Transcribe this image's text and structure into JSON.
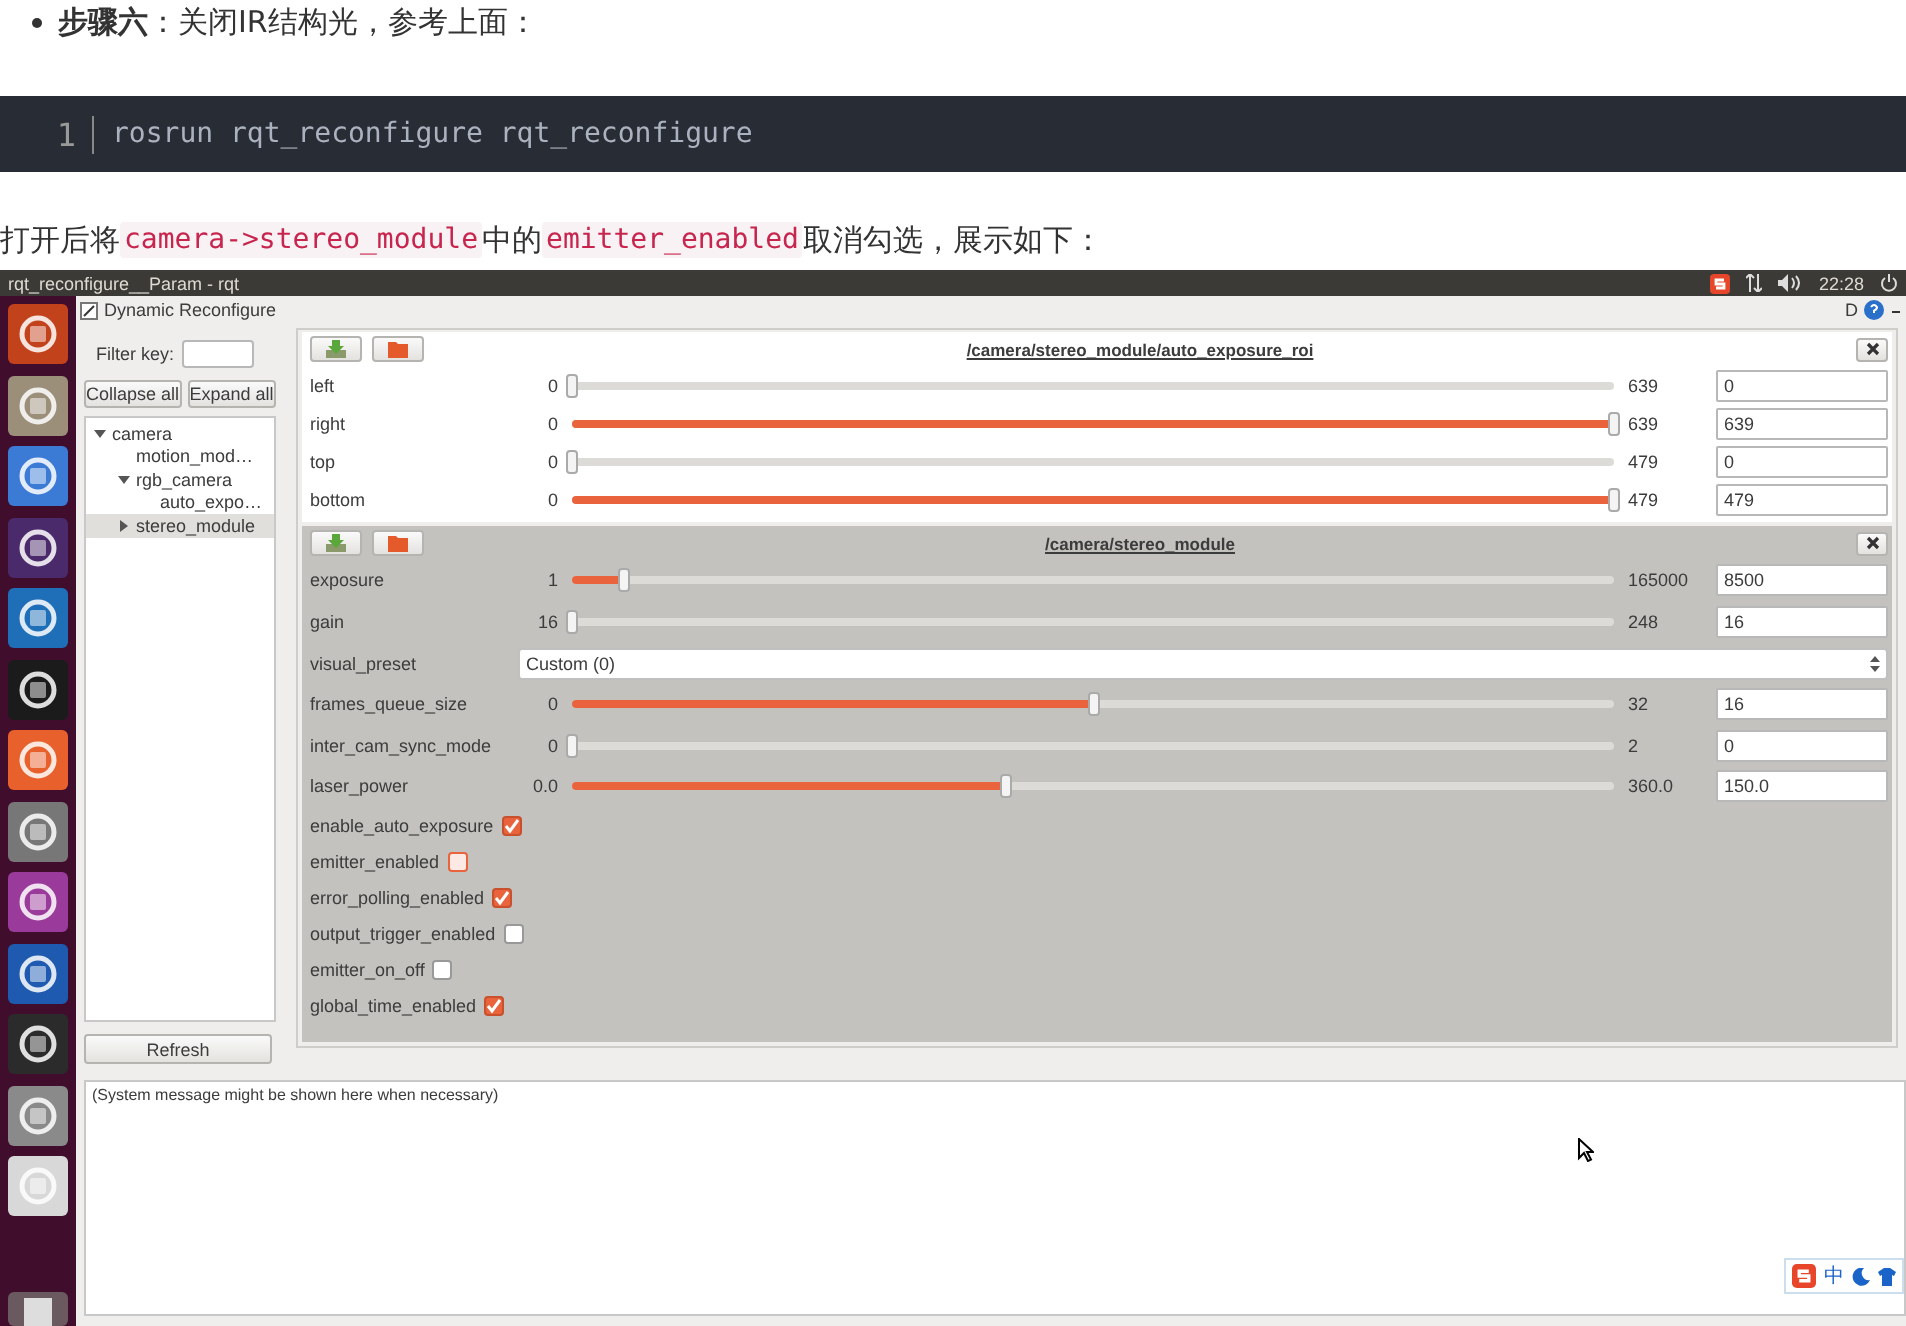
{
  "blog": {
    "bullet": {
      "lead": "步骤六",
      "text": "：关闭IR结构光，参考上面："
    },
    "code_block": {
      "line_number": "1",
      "code": "rosrun rqt_reconfigure rqt_reconfigure"
    },
    "paragraph": [
      {
        "kind": "text",
        "text": "打开后将"
      },
      {
        "kind": "code",
        "text": "camera->stereo_module"
      },
      {
        "kind": "text",
        "text": "中的"
      },
      {
        "kind": "code",
        "text": "emitter_enabled"
      },
      {
        "kind": "text",
        "text": "取消勾选，展示如下："
      }
    ]
  },
  "top_bar": {
    "title": "rqt_reconfigure__Param - rqt",
    "clock": "22:28"
  },
  "plugin": {
    "title": "Dynamic Reconfigure",
    "help": "D"
  },
  "left_panel": {
    "filter_label": "Filter key:",
    "buttons": [
      "Collapse all",
      "Expand all"
    ],
    "tree": [
      {
        "label": "camera",
        "expanded": true,
        "selected": false,
        "children": [
          {
            "label": "motion_mod…",
            "selected": false
          },
          {
            "label": "rgb_camera",
            "expanded": true,
            "selected": false,
            "children": [
              {
                "label": "auto_expo…",
                "selected": false
              }
            ]
          },
          {
            "label": "stereo_module",
            "expanded": false,
            "selected": true
          }
        ]
      }
    ],
    "refresh": "Refresh"
  },
  "groups": [
    {
      "title": "/camera/stereo_module/auto_exposure_roi",
      "selected": false,
      "params": [
        {
          "kind": "slider",
          "name": "left",
          "min": "0",
          "max": "639",
          "level": 0,
          "value": "0"
        },
        {
          "kind": "slider",
          "name": "right",
          "min": "0",
          "max": "639",
          "level": 1,
          "value": "639"
        },
        {
          "kind": "slider",
          "name": "top",
          "min": "0",
          "max": "479",
          "level": 0,
          "value": "0"
        },
        {
          "kind": "slider",
          "name": "bottom",
          "min": "0",
          "max": "479",
          "level": 1,
          "value": "479"
        }
      ]
    },
    {
      "title": "/camera/stereo_module",
      "selected": true,
      "params": [
        {
          "kind": "slider",
          "name": "exposure",
          "min": "1",
          "max": "165000",
          "level": 0.05,
          "value": "8500"
        },
        {
          "kind": "slider",
          "name": "gain",
          "min": "16",
          "max": "248",
          "level": 0,
          "value": "16"
        },
        {
          "kind": "dropdown",
          "name": "visual_preset",
          "value": "Custom (0)"
        },
        {
          "kind": "slider",
          "name": "frames_queue_size",
          "min": "0",
          "max": "32",
          "level": 0.5,
          "value": "16"
        },
        {
          "kind": "slider",
          "name": "inter_cam_sync_mode",
          "min": "0",
          "max": "2",
          "level": 0,
          "value": "0"
        },
        {
          "kind": "slider",
          "name": "laser_power",
          "min": "0.0",
          "max": "360.0",
          "level": 0.417,
          "value": "150.0"
        },
        {
          "kind": "checkbox",
          "name": "enable_auto_exposure",
          "checked": true
        },
        {
          "kind": "checkbox",
          "name": "emitter_enabled",
          "checked": false,
          "hovered": true
        },
        {
          "kind": "checkbox",
          "name": "error_polling_enabled",
          "checked": true
        },
        {
          "kind": "checkbox",
          "name": "output_trigger_enabled",
          "checked": false
        },
        {
          "kind": "checkbox",
          "name": "emitter_on_off",
          "checked": false
        },
        {
          "kind": "checkbox",
          "name": "global_time_enabled",
          "checked": true
        }
      ]
    }
  ],
  "message_box": {
    "text": "(System message might be shown here when necessary)"
  },
  "ime_bar": {
    "mode": "中"
  }
}
